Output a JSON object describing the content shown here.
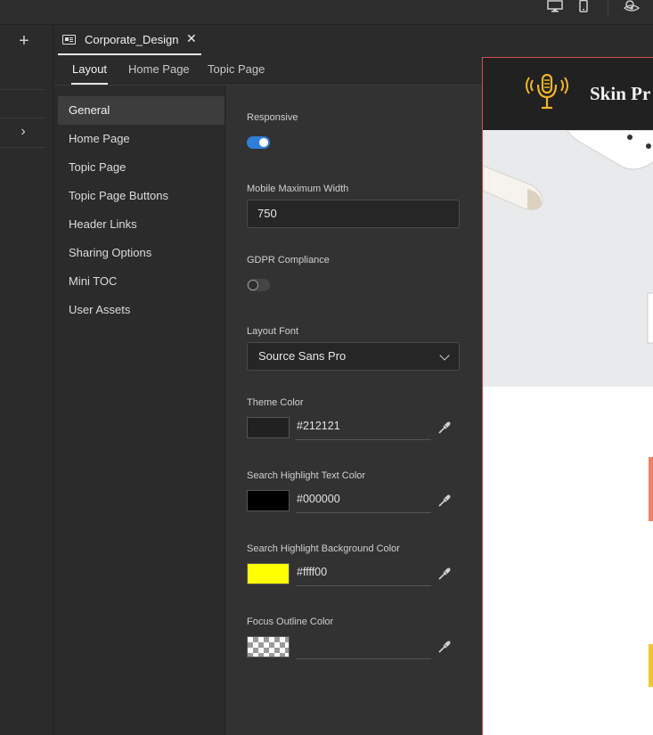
{
  "document_tab": {
    "label": "Corporate_Design",
    "close_label": "✕"
  },
  "subtabs": [
    {
      "label": "Layout"
    },
    {
      "label": "Home Page"
    },
    {
      "label": "Topic Page"
    }
  ],
  "nav": {
    "items": [
      {
        "label": "General"
      },
      {
        "label": "Home Page"
      },
      {
        "label": "Topic Page"
      },
      {
        "label": "Topic Page Buttons"
      },
      {
        "label": "Header Links"
      },
      {
        "label": "Sharing Options"
      },
      {
        "label": "Mini TOC"
      },
      {
        "label": "User Assets"
      }
    ],
    "active": "General"
  },
  "form": {
    "responsive": {
      "label": "Responsive",
      "value": true
    },
    "mobile_max_width": {
      "label": "Mobile Maximum Width",
      "value": "750"
    },
    "gdpr": {
      "label": "GDPR Compliance",
      "value": false
    },
    "layout_font": {
      "label": "Layout Font",
      "value": "Source Sans Pro"
    },
    "theme_color": {
      "label": "Theme Color",
      "value": "#212121",
      "swatch": "#212121"
    },
    "search_highlight_text_color": {
      "label": "Search Highlight Text Color",
      "value": "#000000",
      "swatch": "#000000"
    },
    "search_highlight_bg_color": {
      "label": "Search Highlight Background Color",
      "value": "#ffff00",
      "swatch": "#ffff00"
    },
    "focus_outline_color": {
      "label": "Focus Outline Color",
      "value": ""
    }
  },
  "preview": {
    "title": "Skin Pr"
  },
  "icons": {
    "topbar": [
      "desktop-icon",
      "mobile-icon",
      "preview-icon"
    ],
    "rail": [
      "plus-icon",
      "chevron-right-icon"
    ],
    "fields": [
      "eyedropper-icon"
    ],
    "preview": [
      "microphone-logo-icon"
    ]
  },
  "colors": {
    "accent": "#2f7fd8",
    "preview_border": "#d24a4a",
    "logo": "#f0b429"
  }
}
